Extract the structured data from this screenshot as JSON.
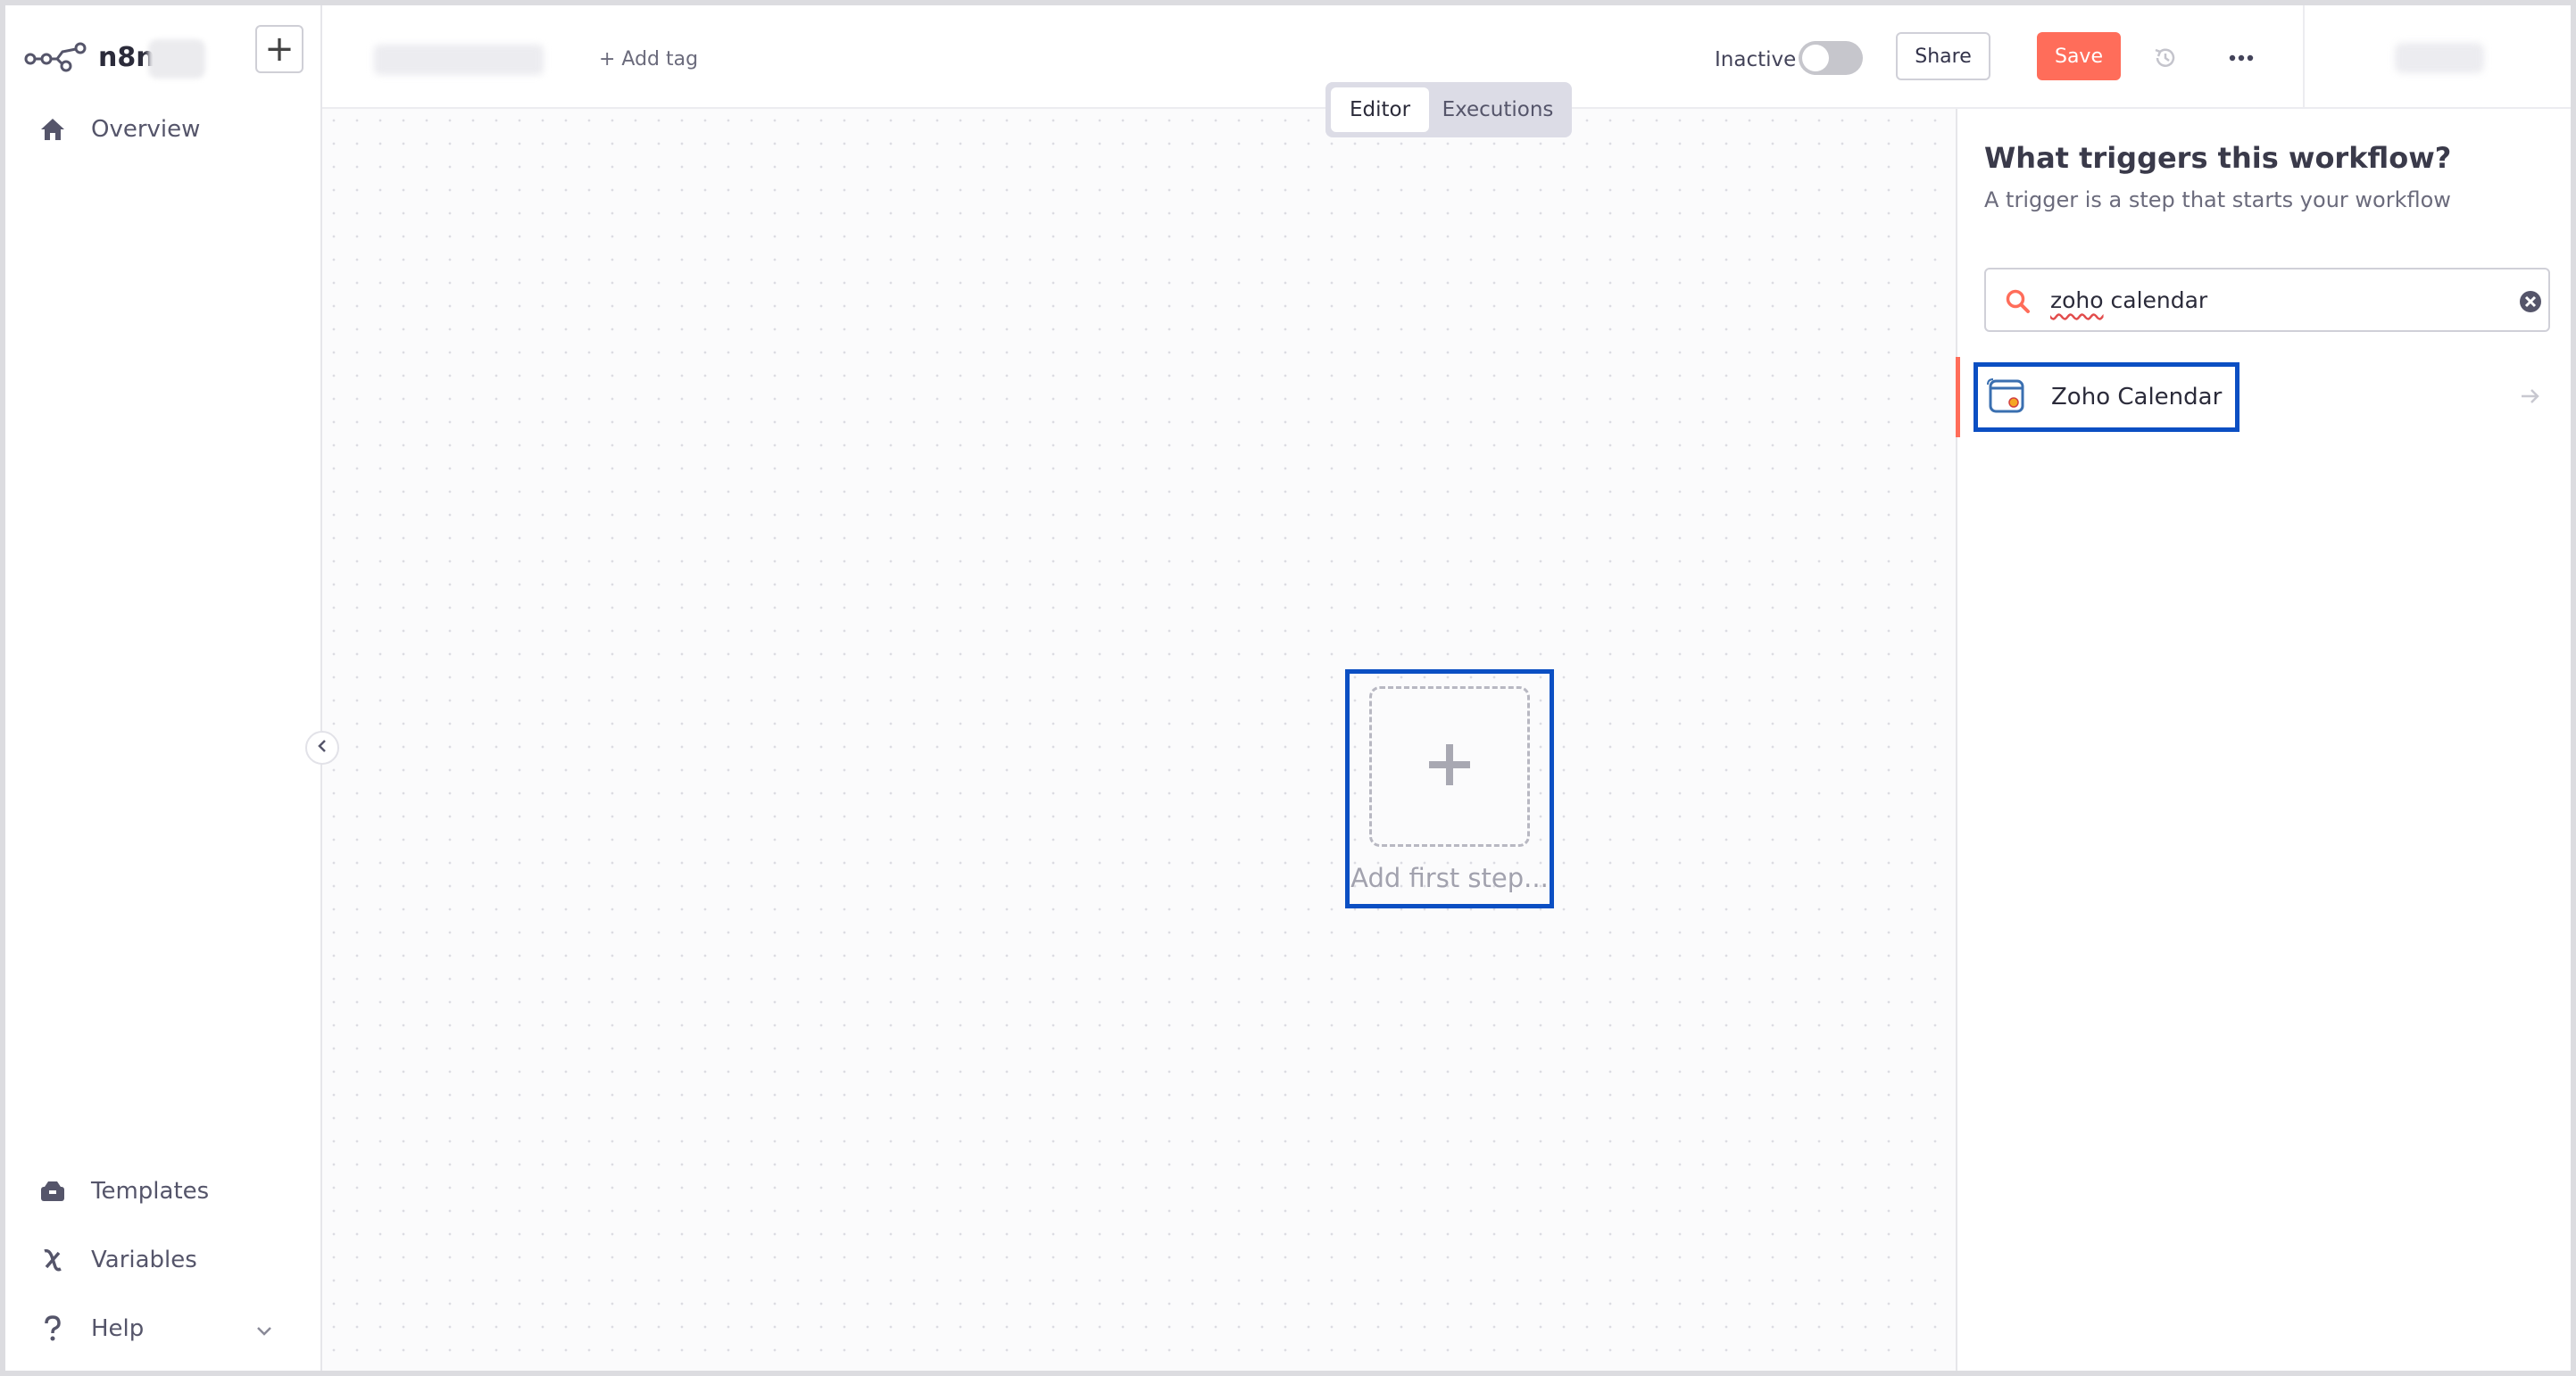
{
  "sidebar": {
    "logo_text": "n8n",
    "new_button": "+",
    "top_items": [
      {
        "label": "Overview",
        "icon": "home-icon"
      }
    ],
    "bottom_items": [
      {
        "label": "Templates",
        "icon": "templates-icon"
      },
      {
        "label": "Variables",
        "icon": "variables-icon"
      },
      {
        "label": "Help",
        "icon": "help-icon"
      }
    ]
  },
  "header": {
    "add_tag": "+ Add tag",
    "status_label": "Inactive",
    "share_label": "Share",
    "save_label": "Save"
  },
  "tabs": [
    {
      "label": "Editor",
      "active": true
    },
    {
      "label": "Executions",
      "active": false
    }
  ],
  "canvas": {
    "add_first_step_label": "Add first step..."
  },
  "panel": {
    "title": "What triggers this workflow?",
    "subtitle": "A trigger is a step that starts your workflow",
    "search_value_word1": "zoho",
    "search_value_rest": " calendar",
    "results": [
      {
        "label": "Zoho Calendar",
        "icon": "zoho-calendar-icon"
      }
    ]
  },
  "colors": {
    "accent": "#ff6d5a",
    "highlight": "#0b4fc3"
  }
}
